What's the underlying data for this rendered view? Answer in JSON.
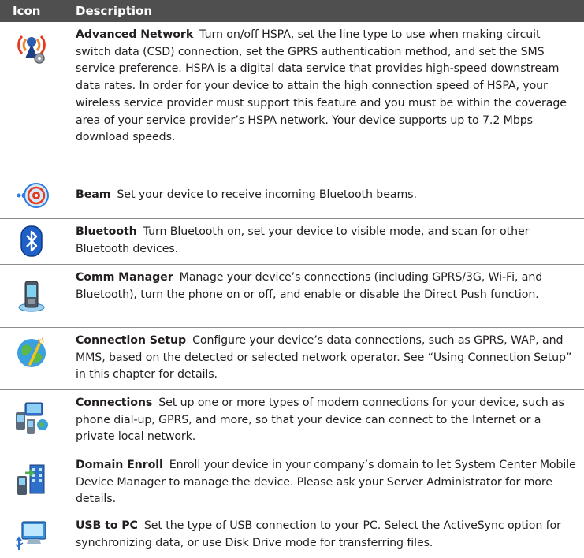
{
  "table": {
    "header": {
      "icon": "Icon",
      "description": "Description"
    },
    "rows": [
      {
        "icon": "advanced-network-icon",
        "title": "Advanced Network",
        "text": "Turn on/off HSPA, set the line type to use when making circuit switch data (CSD) connection, set the GPRS authentication method, and set the SMS service preference. HSPA is a digital data service that provides high-speed downstream data rates. In order for your device to attain the high connection speed of HSPA, your wireless service provider must support this feature and you must be within the coverage area of your service provider’s HSPA network. Your device supports up to 7.2 Mbps download speeds."
      },
      {
        "icon": "beam-icon",
        "title": "Beam",
        "text": "Set your device to receive incoming Bluetooth beams."
      },
      {
        "icon": "bluetooth-icon",
        "title": "Bluetooth",
        "text": "Turn Bluetooth on, set your device to visible mode, and scan for other Bluetooth devices."
      },
      {
        "icon": "comm-manager-icon",
        "title": "Comm Manager",
        "text": "Manage your device’s connections (including GPRS/3G, Wi-Fi, and Bluetooth), turn the phone on or off, and enable or disable the Direct Push function."
      },
      {
        "icon": "connection-setup-icon",
        "title": "Connection Setup",
        "text": "Configure your device’s data connections, such as GPRS, WAP, and MMS, based on the detected or selected network operator. See “Using Connection Setup” in this chapter for details."
      },
      {
        "icon": "connections-icon",
        "title": "Connections",
        "text": "Set up one or more types of modem connections for your device, such as phone dial-up, GPRS, and more, so that your device can connect to the Internet or a private local network."
      },
      {
        "icon": "domain-enroll-icon",
        "title": "Domain Enroll",
        "text": "Enroll your device in your company’s domain to let System Center Mobile Device Manager to manage the device. Please ask your Server Administrator for more details."
      },
      {
        "icon": "usb-to-pc-icon",
        "title": "USB to PC",
        "text": "Set the type of USB connection to your PC. Select the ActiveSync option for synchronizing data, or use Disk Drive mode for transferring files."
      }
    ]
  }
}
